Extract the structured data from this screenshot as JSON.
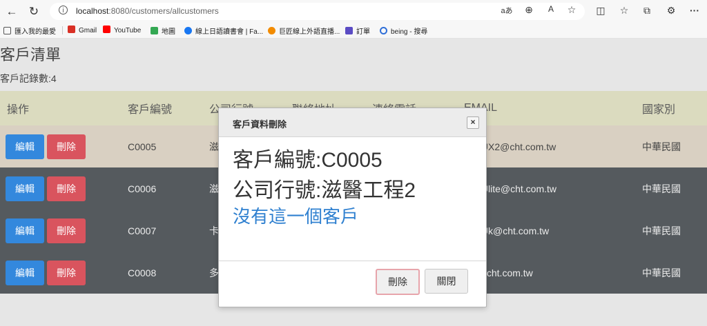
{
  "browser": {
    "url_host": "localhost",
    "url_path": ":8080/customers/allcustomers",
    "bookmarks": [
      {
        "label": "匯入我的最愛",
        "color": "#555555",
        "icon": "folder-icon"
      },
      {
        "label": "Gmail",
        "color": "#d93025",
        "icon": "gmail-icon"
      },
      {
        "label": "YouTube",
        "color": "#ff0000",
        "icon": "youtube-icon"
      },
      {
        "label": "地圖",
        "color": "#34a853",
        "icon": "maps-icon"
      },
      {
        "label": "線上日語讀書會 | Fa...",
        "color": "#1877f2",
        "icon": "facebook-icon"
      },
      {
        "label": "巨匠線上外語直播...",
        "color": "#f28b00",
        "icon": "g-logo-icon"
      },
      {
        "label": "訂單",
        "color": "#5b4cc4",
        "icon": "book-icon"
      },
      {
        "label": "being - 搜尋",
        "color": "#2f6fd8",
        "icon": "search-icon"
      }
    ]
  },
  "page": {
    "title": "客戶清單",
    "record_count": "客戶記錄數:4"
  },
  "table": {
    "headers": [
      "操作",
      "客戶編號",
      "公司行號",
      "聯絡地址",
      "連絡電話",
      "EMAIL",
      "國家別"
    ],
    "rows": [
      {
        "id": "C0005",
        "company": "滋",
        "email": "gTZUX2@cht.com.tw",
        "country": "中華民國"
      },
      {
        "id": "C0006",
        "company": "滋",
        "email": "gTZUlite@cht.com.tw",
        "country": "中華民國"
      },
      {
        "id": "C0007",
        "company": "卡",
        "email": "gTZUk@cht.com.tw",
        "country": "中華民國"
      },
      {
        "id": "C0008",
        "company": "多",
        "email": "ZU@cht.com.tw",
        "country": "中華民國"
      }
    ],
    "edit_label": "編輯",
    "delete_label": "刪除"
  },
  "modal": {
    "title": "客戶資料刪除",
    "line1": "客戶編號:C0005",
    "line2": "公司行號:滋醫工程2",
    "message": "沒有這一個客戶",
    "delete_button": "刪除",
    "close_button": "關閉"
  }
}
